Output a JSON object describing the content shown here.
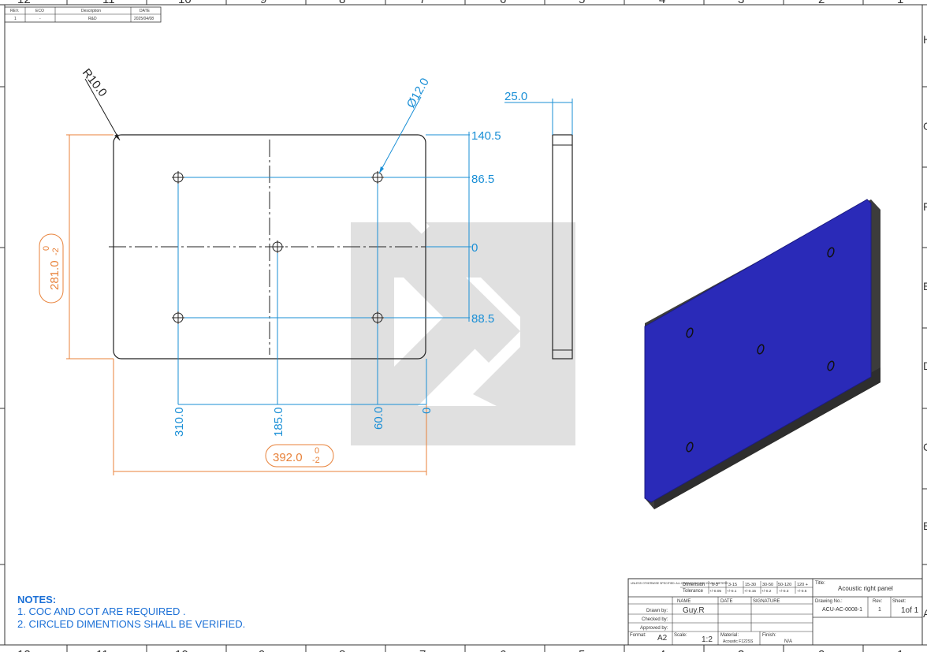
{
  "revision_table": {
    "headers": [
      "REV.",
      "ECO",
      "Description",
      "DATE"
    ],
    "row": [
      "1",
      "-",
      "R&D",
      "2025/04/08"
    ]
  },
  "zones": {
    "top": [
      "12",
      "11",
      "10",
      "9",
      "8",
      "7",
      "6",
      "5",
      "4",
      "3",
      "2",
      "1"
    ],
    "bottom": [
      "12",
      "11",
      "10",
      "9",
      "8",
      "7",
      "6",
      "5",
      "4",
      "3",
      "2",
      "1"
    ],
    "right": [
      "H",
      "G",
      "F",
      "E",
      "D",
      "C",
      "B",
      "A"
    ]
  },
  "dimensions": {
    "corner_radius": "R10.0",
    "hole_dia": "Ø12.0",
    "thickness": "25.0",
    "height_tol": "281.0",
    "height_tol_upper": "0",
    "height_tol_lower": "-2",
    "width_tol": "392.0",
    "width_tol_upper": "0",
    "width_tol_lower": "-2",
    "ordinate_right": [
      "140.5",
      "86.5",
      "0",
      "88.5"
    ],
    "ordinate_bottom": [
      "310.0",
      "185.0",
      "60.0",
      "0"
    ]
  },
  "notes": {
    "title": "NOTES:",
    "lines": [
      "1.  COC AND COT ARE REQUIRED .",
      "2.  CIRCLED DIMENTIONS SHALL BE VERIFIED."
    ]
  },
  "title_block": {
    "unless_text": "UNLESS OTHERWISE SPECIFIED: ALL DIMENSIONS ARE IN MILLIMETERS",
    "dim_label": "Dimension",
    "tol_label": "Tolerance",
    "dim_ranges": [
      "0-3",
      "3-15",
      "15-30",
      "30-50",
      "50-120",
      "120 +"
    ],
    "tol_values": [
      "+/-0.05",
      "+/-0.1",
      "+/-0.15",
      "+/-0.2",
      "+/-0.3",
      "+/-0.5"
    ],
    "title_label": "Title:",
    "title": "Acoustic right panel",
    "name_col": "NAME",
    "date_col": "DATE",
    "signature_col": "SIGNATURE",
    "drawn_by_label": "Drawn by:",
    "drawn_by": "Guy.R",
    "checked_by_label": "Checked by:",
    "approved_by_label": "Approved by:",
    "drawing_no_label": "Drawing No.:",
    "drawing_no": "ACU-AC-0008-1",
    "rev_label": "Rev:",
    "rev": "1",
    "sheet_label": "Sheet:",
    "sheet": "1of 1",
    "format_label": "Format:",
    "format": "A2",
    "scale_label": "Scale:",
    "scale": "1:2",
    "material_label": "Material:",
    "material": "Acoustic F122SS",
    "finish_label": "Finish:",
    "finish": "N/A"
  },
  "colors": {
    "dimension_blue": "#1a8fd6",
    "verify_orange": "#e8823a",
    "panel_face": "#2a2ab8",
    "panel_edge": "#3a3a3a"
  }
}
